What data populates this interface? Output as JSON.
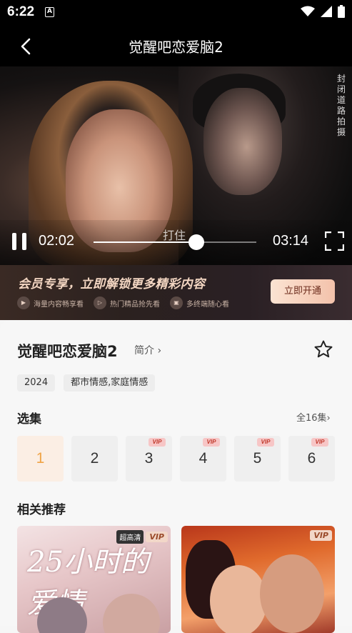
{
  "status": {
    "time": "6:22",
    "app_icon": "A"
  },
  "nav": {
    "title": "觉醒吧恋爱脑2"
  },
  "player": {
    "watermark": "封闭道路拍摄",
    "subtitle": "打住",
    "current_time": "02:02",
    "duration": "03:14",
    "progress": 0.63
  },
  "vip_banner": {
    "title": "会员专享，立即解锁更多精彩内容",
    "features": [
      {
        "icon": "play-box-icon",
        "label": "海量内容畅享看"
      },
      {
        "icon": "play-circle-icon",
        "label": "热门精品抢先看"
      },
      {
        "icon": "multi-device-icon",
        "label": "多终端随心看"
      }
    ],
    "button": "立即开通"
  },
  "show": {
    "title": "觉醒吧恋爱脑2",
    "intro_link": "简介",
    "tags": [
      "2024",
      "都市情感,家庭情感"
    ]
  },
  "episodes": {
    "section_title": "选集",
    "all_link": "全16集",
    "vip_badge": "VIP",
    "items": [
      {
        "num": "1",
        "vip": false,
        "active": true
      },
      {
        "num": "2",
        "vip": false,
        "active": false
      },
      {
        "num": "3",
        "vip": true,
        "active": false
      },
      {
        "num": "4",
        "vip": true,
        "active": false
      },
      {
        "num": "5",
        "vip": true,
        "active": false
      },
      {
        "num": "6",
        "vip": true,
        "active": false
      }
    ]
  },
  "recommend": {
    "section_title": "相关推荐",
    "items": [
      {
        "title_art": "25小时的爱情",
        "hd": "超高清",
        "vip": "VIP"
      },
      {
        "title_art": "",
        "hd": "",
        "vip": "VIP"
      }
    ]
  },
  "colors": {
    "accent": "#f0a346",
    "vip_red": "#c0392b",
    "banner_btn": "#f3c2ab"
  }
}
